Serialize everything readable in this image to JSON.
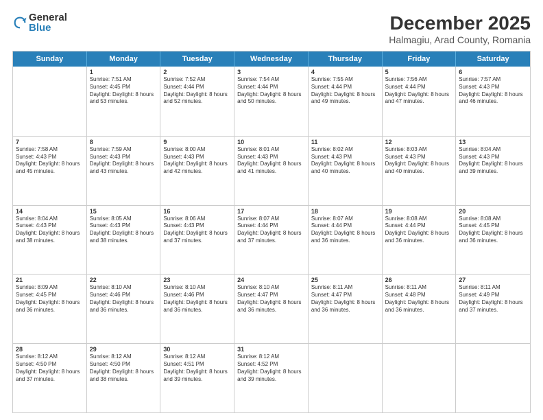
{
  "logo": {
    "general": "General",
    "blue": "Blue"
  },
  "title": "December 2025",
  "location": "Halmagiu, Arad County, Romania",
  "days": [
    "Sunday",
    "Monday",
    "Tuesday",
    "Wednesday",
    "Thursday",
    "Friday",
    "Saturday"
  ],
  "weeks": [
    [
      {
        "day": "",
        "sunrise": "",
        "sunset": "",
        "daylight": ""
      },
      {
        "day": "1",
        "sunrise": "Sunrise: 7:51 AM",
        "sunset": "Sunset: 4:45 PM",
        "daylight": "Daylight: 8 hours and 53 minutes."
      },
      {
        "day": "2",
        "sunrise": "Sunrise: 7:52 AM",
        "sunset": "Sunset: 4:44 PM",
        "daylight": "Daylight: 8 hours and 52 minutes."
      },
      {
        "day": "3",
        "sunrise": "Sunrise: 7:54 AM",
        "sunset": "Sunset: 4:44 PM",
        "daylight": "Daylight: 8 hours and 50 minutes."
      },
      {
        "day": "4",
        "sunrise": "Sunrise: 7:55 AM",
        "sunset": "Sunset: 4:44 PM",
        "daylight": "Daylight: 8 hours and 49 minutes."
      },
      {
        "day": "5",
        "sunrise": "Sunrise: 7:56 AM",
        "sunset": "Sunset: 4:44 PM",
        "daylight": "Daylight: 8 hours and 47 minutes."
      },
      {
        "day": "6",
        "sunrise": "Sunrise: 7:57 AM",
        "sunset": "Sunset: 4:43 PM",
        "daylight": "Daylight: 8 hours and 46 minutes."
      }
    ],
    [
      {
        "day": "7",
        "sunrise": "Sunrise: 7:58 AM",
        "sunset": "Sunset: 4:43 PM",
        "daylight": "Daylight: 8 hours and 45 minutes."
      },
      {
        "day": "8",
        "sunrise": "Sunrise: 7:59 AM",
        "sunset": "Sunset: 4:43 PM",
        "daylight": "Daylight: 8 hours and 43 minutes."
      },
      {
        "day": "9",
        "sunrise": "Sunrise: 8:00 AM",
        "sunset": "Sunset: 4:43 PM",
        "daylight": "Daylight: 8 hours and 42 minutes."
      },
      {
        "day": "10",
        "sunrise": "Sunrise: 8:01 AM",
        "sunset": "Sunset: 4:43 PM",
        "daylight": "Daylight: 8 hours and 41 minutes."
      },
      {
        "day": "11",
        "sunrise": "Sunrise: 8:02 AM",
        "sunset": "Sunset: 4:43 PM",
        "daylight": "Daylight: 8 hours and 40 minutes."
      },
      {
        "day": "12",
        "sunrise": "Sunrise: 8:03 AM",
        "sunset": "Sunset: 4:43 PM",
        "daylight": "Daylight: 8 hours and 40 minutes."
      },
      {
        "day": "13",
        "sunrise": "Sunrise: 8:04 AM",
        "sunset": "Sunset: 4:43 PM",
        "daylight": "Daylight: 8 hours and 39 minutes."
      }
    ],
    [
      {
        "day": "14",
        "sunrise": "Sunrise: 8:04 AM",
        "sunset": "Sunset: 4:43 PM",
        "daylight": "Daylight: 8 hours and 38 minutes."
      },
      {
        "day": "15",
        "sunrise": "Sunrise: 8:05 AM",
        "sunset": "Sunset: 4:43 PM",
        "daylight": "Daylight: 8 hours and 38 minutes."
      },
      {
        "day": "16",
        "sunrise": "Sunrise: 8:06 AM",
        "sunset": "Sunset: 4:43 PM",
        "daylight": "Daylight: 8 hours and 37 minutes."
      },
      {
        "day": "17",
        "sunrise": "Sunrise: 8:07 AM",
        "sunset": "Sunset: 4:44 PM",
        "daylight": "Daylight: 8 hours and 37 minutes."
      },
      {
        "day": "18",
        "sunrise": "Sunrise: 8:07 AM",
        "sunset": "Sunset: 4:44 PM",
        "daylight": "Daylight: 8 hours and 36 minutes."
      },
      {
        "day": "19",
        "sunrise": "Sunrise: 8:08 AM",
        "sunset": "Sunset: 4:44 PM",
        "daylight": "Daylight: 8 hours and 36 minutes."
      },
      {
        "day": "20",
        "sunrise": "Sunrise: 8:08 AM",
        "sunset": "Sunset: 4:45 PM",
        "daylight": "Daylight: 8 hours and 36 minutes."
      }
    ],
    [
      {
        "day": "21",
        "sunrise": "Sunrise: 8:09 AM",
        "sunset": "Sunset: 4:45 PM",
        "daylight": "Daylight: 8 hours and 36 minutes."
      },
      {
        "day": "22",
        "sunrise": "Sunrise: 8:10 AM",
        "sunset": "Sunset: 4:46 PM",
        "daylight": "Daylight: 8 hours and 36 minutes."
      },
      {
        "day": "23",
        "sunrise": "Sunrise: 8:10 AM",
        "sunset": "Sunset: 4:46 PM",
        "daylight": "Daylight: 8 hours and 36 minutes."
      },
      {
        "day": "24",
        "sunrise": "Sunrise: 8:10 AM",
        "sunset": "Sunset: 4:47 PM",
        "daylight": "Daylight: 8 hours and 36 minutes."
      },
      {
        "day": "25",
        "sunrise": "Sunrise: 8:11 AM",
        "sunset": "Sunset: 4:47 PM",
        "daylight": "Daylight: 8 hours and 36 minutes."
      },
      {
        "day": "26",
        "sunrise": "Sunrise: 8:11 AM",
        "sunset": "Sunset: 4:48 PM",
        "daylight": "Daylight: 8 hours and 36 minutes."
      },
      {
        "day": "27",
        "sunrise": "Sunrise: 8:11 AM",
        "sunset": "Sunset: 4:49 PM",
        "daylight": "Daylight: 8 hours and 37 minutes."
      }
    ],
    [
      {
        "day": "28",
        "sunrise": "Sunrise: 8:12 AM",
        "sunset": "Sunset: 4:50 PM",
        "daylight": "Daylight: 8 hours and 37 minutes."
      },
      {
        "day": "29",
        "sunrise": "Sunrise: 8:12 AM",
        "sunset": "Sunset: 4:50 PM",
        "daylight": "Daylight: 8 hours and 38 minutes."
      },
      {
        "day": "30",
        "sunrise": "Sunrise: 8:12 AM",
        "sunset": "Sunset: 4:51 PM",
        "daylight": "Daylight: 8 hours and 39 minutes."
      },
      {
        "day": "31",
        "sunrise": "Sunrise: 8:12 AM",
        "sunset": "Sunset: 4:52 PM",
        "daylight": "Daylight: 8 hours and 39 minutes."
      },
      {
        "day": "",
        "sunrise": "",
        "sunset": "",
        "daylight": ""
      },
      {
        "day": "",
        "sunrise": "",
        "sunset": "",
        "daylight": ""
      },
      {
        "day": "",
        "sunrise": "",
        "sunset": "",
        "daylight": ""
      }
    ]
  ]
}
